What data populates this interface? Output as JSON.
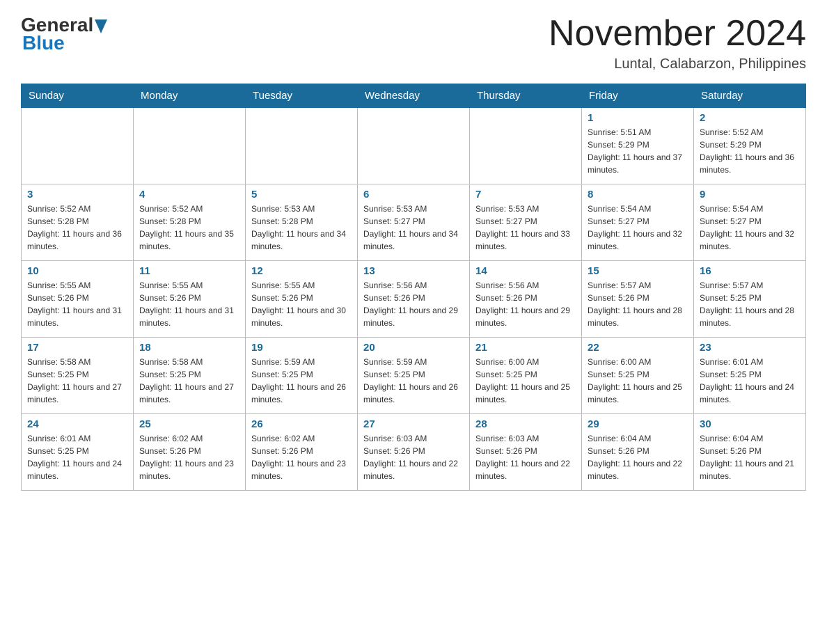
{
  "header": {
    "logo_general": "General",
    "logo_blue": "Blue",
    "title": "November 2024",
    "subtitle": "Luntal, Calabarzon, Philippines"
  },
  "weekdays": [
    "Sunday",
    "Monday",
    "Tuesday",
    "Wednesday",
    "Thursday",
    "Friday",
    "Saturday"
  ],
  "rows": [
    [
      {
        "day": "",
        "info": ""
      },
      {
        "day": "",
        "info": ""
      },
      {
        "day": "",
        "info": ""
      },
      {
        "day": "",
        "info": ""
      },
      {
        "day": "",
        "info": ""
      },
      {
        "day": "1",
        "info": "Sunrise: 5:51 AM\nSunset: 5:29 PM\nDaylight: 11 hours and 37 minutes."
      },
      {
        "day": "2",
        "info": "Sunrise: 5:52 AM\nSunset: 5:29 PM\nDaylight: 11 hours and 36 minutes."
      }
    ],
    [
      {
        "day": "3",
        "info": "Sunrise: 5:52 AM\nSunset: 5:28 PM\nDaylight: 11 hours and 36 minutes."
      },
      {
        "day": "4",
        "info": "Sunrise: 5:52 AM\nSunset: 5:28 PM\nDaylight: 11 hours and 35 minutes."
      },
      {
        "day": "5",
        "info": "Sunrise: 5:53 AM\nSunset: 5:28 PM\nDaylight: 11 hours and 34 minutes."
      },
      {
        "day": "6",
        "info": "Sunrise: 5:53 AM\nSunset: 5:27 PM\nDaylight: 11 hours and 34 minutes."
      },
      {
        "day": "7",
        "info": "Sunrise: 5:53 AM\nSunset: 5:27 PM\nDaylight: 11 hours and 33 minutes."
      },
      {
        "day": "8",
        "info": "Sunrise: 5:54 AM\nSunset: 5:27 PM\nDaylight: 11 hours and 32 minutes."
      },
      {
        "day": "9",
        "info": "Sunrise: 5:54 AM\nSunset: 5:27 PM\nDaylight: 11 hours and 32 minutes."
      }
    ],
    [
      {
        "day": "10",
        "info": "Sunrise: 5:55 AM\nSunset: 5:26 PM\nDaylight: 11 hours and 31 minutes."
      },
      {
        "day": "11",
        "info": "Sunrise: 5:55 AM\nSunset: 5:26 PM\nDaylight: 11 hours and 31 minutes."
      },
      {
        "day": "12",
        "info": "Sunrise: 5:55 AM\nSunset: 5:26 PM\nDaylight: 11 hours and 30 minutes."
      },
      {
        "day": "13",
        "info": "Sunrise: 5:56 AM\nSunset: 5:26 PM\nDaylight: 11 hours and 29 minutes."
      },
      {
        "day": "14",
        "info": "Sunrise: 5:56 AM\nSunset: 5:26 PM\nDaylight: 11 hours and 29 minutes."
      },
      {
        "day": "15",
        "info": "Sunrise: 5:57 AM\nSunset: 5:26 PM\nDaylight: 11 hours and 28 minutes."
      },
      {
        "day": "16",
        "info": "Sunrise: 5:57 AM\nSunset: 5:25 PM\nDaylight: 11 hours and 28 minutes."
      }
    ],
    [
      {
        "day": "17",
        "info": "Sunrise: 5:58 AM\nSunset: 5:25 PM\nDaylight: 11 hours and 27 minutes."
      },
      {
        "day": "18",
        "info": "Sunrise: 5:58 AM\nSunset: 5:25 PM\nDaylight: 11 hours and 27 minutes."
      },
      {
        "day": "19",
        "info": "Sunrise: 5:59 AM\nSunset: 5:25 PM\nDaylight: 11 hours and 26 minutes."
      },
      {
        "day": "20",
        "info": "Sunrise: 5:59 AM\nSunset: 5:25 PM\nDaylight: 11 hours and 26 minutes."
      },
      {
        "day": "21",
        "info": "Sunrise: 6:00 AM\nSunset: 5:25 PM\nDaylight: 11 hours and 25 minutes."
      },
      {
        "day": "22",
        "info": "Sunrise: 6:00 AM\nSunset: 5:25 PM\nDaylight: 11 hours and 25 minutes."
      },
      {
        "day": "23",
        "info": "Sunrise: 6:01 AM\nSunset: 5:25 PM\nDaylight: 11 hours and 24 minutes."
      }
    ],
    [
      {
        "day": "24",
        "info": "Sunrise: 6:01 AM\nSunset: 5:25 PM\nDaylight: 11 hours and 24 minutes."
      },
      {
        "day": "25",
        "info": "Sunrise: 6:02 AM\nSunset: 5:26 PM\nDaylight: 11 hours and 23 minutes."
      },
      {
        "day": "26",
        "info": "Sunrise: 6:02 AM\nSunset: 5:26 PM\nDaylight: 11 hours and 23 minutes."
      },
      {
        "day": "27",
        "info": "Sunrise: 6:03 AM\nSunset: 5:26 PM\nDaylight: 11 hours and 22 minutes."
      },
      {
        "day": "28",
        "info": "Sunrise: 6:03 AM\nSunset: 5:26 PM\nDaylight: 11 hours and 22 minutes."
      },
      {
        "day": "29",
        "info": "Sunrise: 6:04 AM\nSunset: 5:26 PM\nDaylight: 11 hours and 22 minutes."
      },
      {
        "day": "30",
        "info": "Sunrise: 6:04 AM\nSunset: 5:26 PM\nDaylight: 11 hours and 21 minutes."
      }
    ]
  ]
}
